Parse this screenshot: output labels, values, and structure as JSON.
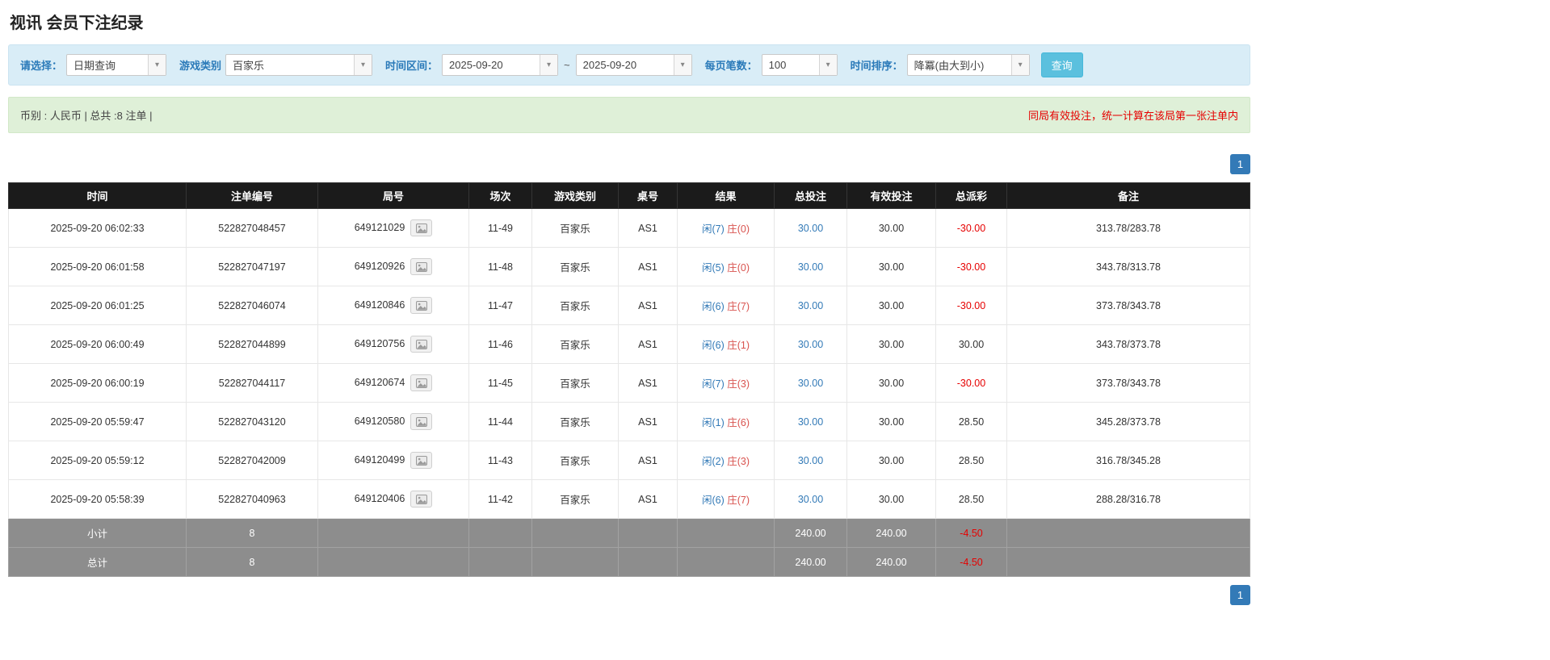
{
  "page": {
    "title": "视讯 会员下注纪录"
  },
  "filter_bar": {
    "query_type": {
      "label": "请选择：",
      "value": "日期查询"
    },
    "game_type": {
      "label": "游戏类别",
      "value": "百家乐"
    },
    "date_range": {
      "label": "时间区间：",
      "from": "2025-09-20",
      "separator": "~",
      "to": "2025-09-20"
    },
    "page_size": {
      "label": "每页笔数：",
      "value": "100"
    },
    "time_sort": {
      "label": "时间排序：",
      "value": "降冪(由大到小)"
    },
    "search_button": "查询"
  },
  "summary_bar": {
    "currency_info": "币别 : 人民币 | 总共 :8 注单 |",
    "note": "同局有效投注，统一计算在该局第一张注单内"
  },
  "pagination": {
    "current_page": "1"
  },
  "table": {
    "headers": [
      "时间",
      "注单编号",
      "局号",
      "场次",
      "游戏类别",
      "桌号",
      "结果",
      "总投注",
      "有效投注",
      "总派彩",
      "备注"
    ],
    "rows": [
      {
        "time": "2025-09-20 06:02:33",
        "bet_id": "522827048457",
        "round_id": "649121029",
        "session": "11-49",
        "game_type": "百家乐",
        "table_no": "AS1",
        "result_player": "闲(7)",
        "result_banker": "庄(0)",
        "total_bet": "30.00",
        "valid_bet": "30.00",
        "payout": "-30.00",
        "remark": "313.78/283.78"
      },
      {
        "time": "2025-09-20 06:01:58",
        "bet_id": "522827047197",
        "round_id": "649120926",
        "session": "11-48",
        "game_type": "百家乐",
        "table_no": "AS1",
        "result_player": "闲(5)",
        "result_banker": "庄(0)",
        "total_bet": "30.00",
        "valid_bet": "30.00",
        "payout": "-30.00",
        "remark": "343.78/313.78"
      },
      {
        "time": "2025-09-20 06:01:25",
        "bet_id": "522827046074",
        "round_id": "649120846",
        "session": "11-47",
        "game_type": "百家乐",
        "table_no": "AS1",
        "result_player": "闲(6)",
        "result_banker": "庄(7)",
        "total_bet": "30.00",
        "valid_bet": "30.00",
        "payout": "-30.00",
        "remark": "373.78/343.78"
      },
      {
        "time": "2025-09-20 06:00:49",
        "bet_id": "522827044899",
        "round_id": "649120756",
        "session": "11-46",
        "game_type": "百家乐",
        "table_no": "AS1",
        "result_player": "闲(6)",
        "result_banker": "庄(1)",
        "total_bet": "30.00",
        "valid_bet": "30.00",
        "payout": "30.00",
        "remark": "343.78/373.78"
      },
      {
        "time": "2025-09-20 06:00:19",
        "bet_id": "522827044117",
        "round_id": "649120674",
        "session": "11-45",
        "game_type": "百家乐",
        "table_no": "AS1",
        "result_player": "闲(7)",
        "result_banker": "庄(3)",
        "total_bet": "30.00",
        "valid_bet": "30.00",
        "payout": "-30.00",
        "remark": "373.78/343.78"
      },
      {
        "time": "2025-09-20 05:59:47",
        "bet_id": "522827043120",
        "round_id": "649120580",
        "session": "11-44",
        "game_type": "百家乐",
        "table_no": "AS1",
        "result_player": "闲(1)",
        "result_banker": "庄(6)",
        "total_bet": "30.00",
        "valid_bet": "30.00",
        "payout": "28.50",
        "remark": "345.28/373.78"
      },
      {
        "time": "2025-09-20 05:59:12",
        "bet_id": "522827042009",
        "round_id": "649120499",
        "session": "11-43",
        "game_type": "百家乐",
        "table_no": "AS1",
        "result_player": "闲(2)",
        "result_banker": "庄(3)",
        "total_bet": "30.00",
        "valid_bet": "30.00",
        "payout": "28.50",
        "remark": "316.78/345.28"
      },
      {
        "time": "2025-09-20 05:58:39",
        "bet_id": "522827040963",
        "round_id": "649120406",
        "session": "11-42",
        "game_type": "百家乐",
        "table_no": "AS1",
        "result_player": "闲(6)",
        "result_banker": "庄(7)",
        "total_bet": "30.00",
        "valid_bet": "30.00",
        "payout": "28.50",
        "remark": "288.28/316.78"
      }
    ],
    "subtotal": {
      "label": "小计",
      "count": "8",
      "total_bet": "240.00",
      "valid_bet": "240.00",
      "payout": "-4.50"
    },
    "total": {
      "label": "总计",
      "count": "8",
      "total_bet": "240.00",
      "valid_bet": "240.00",
      "payout": "-4.50"
    }
  },
  "colors": {
    "accent_blue": "#337ab7",
    "player_blue": "#337ab7",
    "banker_red": "#d9534f",
    "negative_red": "#e60000",
    "search_button_bg": "#5bc0de",
    "filter_bar_bg": "#d9edf7",
    "summary_bar_bg": "#dff0d8",
    "table_header_bg": "#1b1b1b",
    "table_footer_bg": "#8d8d8d"
  },
  "icons": {
    "dropdown_arrow": "▾",
    "round_snapshot": "snapshot-icon"
  }
}
